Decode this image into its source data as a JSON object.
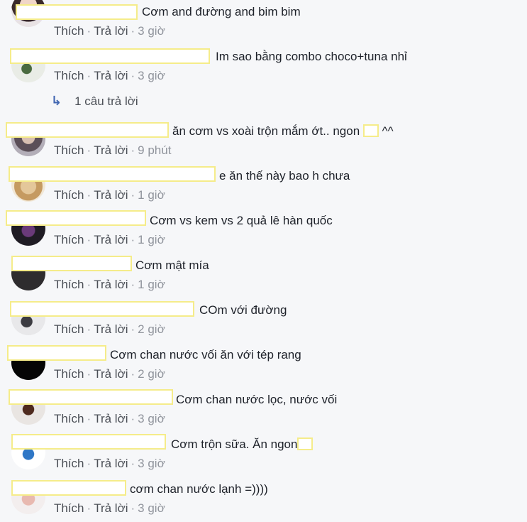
{
  "labels": {
    "like": "Thích",
    "reply": "Trả lời",
    "dot": "·"
  },
  "replies_link": {
    "icon": "reply-arrow-icon",
    "text": "1 câu trả lời"
  },
  "colors": {
    "name_box_border": "#f5ec8a",
    "link": "#4b4f56",
    "timestamp": "#90949c",
    "reply_icon": "#4267b2"
  },
  "comments": [
    {
      "text": "Cơm and đường and bim bim",
      "time": "3 giờ"
    },
    {
      "text": "Im sao bằng combo choco+tuna nhỉ",
      "time": "3 giờ"
    },
    {
      "text": "ăn cơm vs xoài trộn mắm ớt.. ngon",
      "text_after": " ^^",
      "time": "9 phút"
    },
    {
      "text": "e ăn thế này bao h chưa",
      "time": "1 giờ"
    },
    {
      "text": "Cơm vs kem vs 2 quả lê hàn quốc",
      "time": "1 giờ"
    },
    {
      "text": "Cơm mật mía",
      "time": "1 giờ"
    },
    {
      "text": "COm với đường",
      "time": "2 giờ"
    },
    {
      "text": "Cơm chan nước vối ăn với tép rang",
      "time": "2 giờ"
    },
    {
      "text": "Cơm chan nước lọc, nước vối",
      "time": "3 giờ"
    },
    {
      "text": "Cơm trộn sữa. Ăn ngon",
      "time": "3 giờ"
    },
    {
      "text": "cơm chan nước lạnh =))))",
      "time": "3 giờ"
    }
  ]
}
